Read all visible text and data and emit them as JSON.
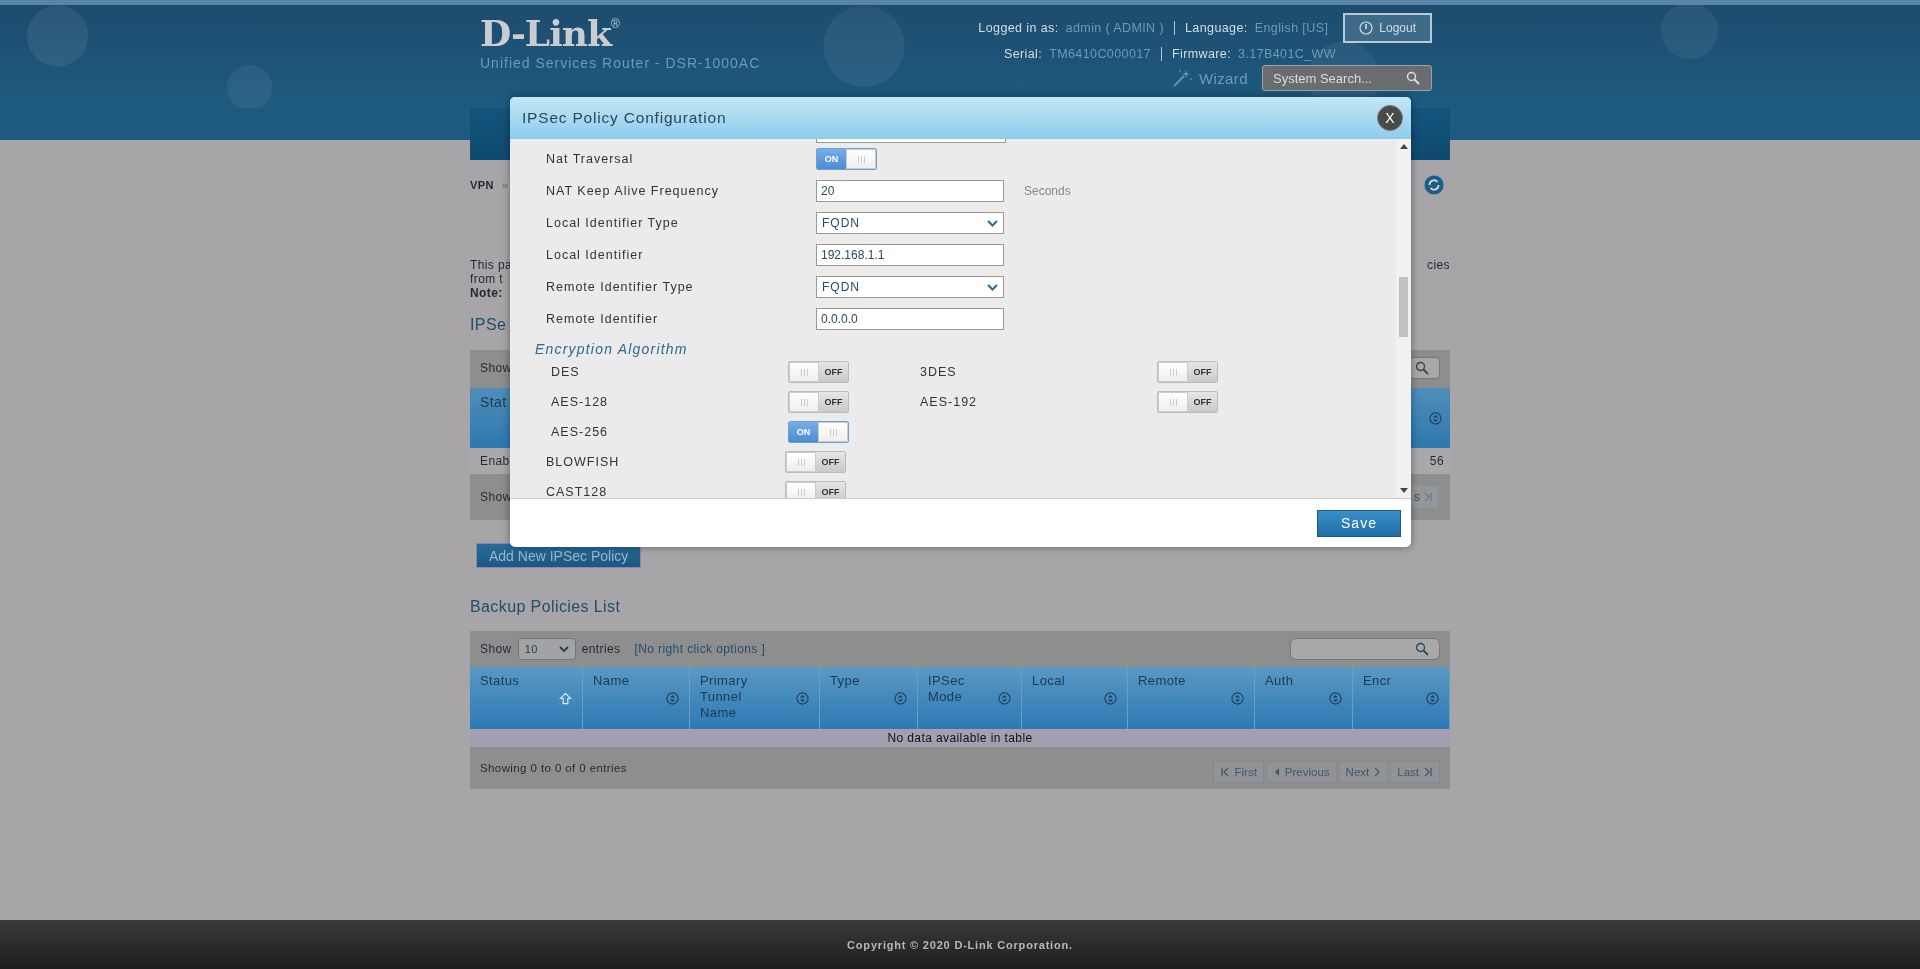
{
  "header": {
    "brand": "D-Link",
    "trademark": "®",
    "subtitle": "Unified Services Router - DSR-1000AC",
    "logged_in_label": "Logged in as:",
    "user": "admin ( ADMIN )",
    "language_label": "Language:",
    "language": "English [US]",
    "logout": "Logout",
    "serial_label": "Serial:",
    "serial": "TM6410C000017",
    "firmware_label": "Firmware:",
    "firmware": "3.17B401C_WW",
    "wizard": "Wizard",
    "search_placeholder": "System Search..."
  },
  "page": {
    "breadcrumb": "VPN",
    "breadcrumb_sep": "»",
    "intro_lines": [
      "This pa",
      "from t",
      "Note:"
    ],
    "intro_tail": "cies"
  },
  "policies": {
    "title": "IPSe",
    "show_label": "Show",
    "status_header": "Stat",
    "row_status": "Enab",
    "row_end": "56",
    "footer_text": "Show",
    "pager_fragment": "s"
  },
  "add_button": "Add New IPSec Policy",
  "backup": {
    "title": "Backup Policies List",
    "show_label": "Show",
    "page_size": "10",
    "entries_label": "entries",
    "hint": "[No right click options ]",
    "columns": [
      {
        "label": "Status",
        "sorted": true
      },
      {
        "label": "Name",
        "sorted": false
      },
      {
        "label": "Primary Tunnel Name",
        "sorted": false
      },
      {
        "label": "Type",
        "sorted": false
      },
      {
        "label": "IPSec Mode",
        "sorted": false
      },
      {
        "label": "Local",
        "sorted": false
      },
      {
        "label": "Remote",
        "sorted": false
      },
      {
        "label": "Auth",
        "sorted": false
      },
      {
        "label": "Encr",
        "sorted": false
      }
    ],
    "empty": "No data available in table",
    "info": "Showing 0 to 0 of 0 entries",
    "pager": [
      {
        "label": "First",
        "disabled": true
      },
      {
        "label": "Previous",
        "disabled": true
      },
      {
        "label": "Next",
        "disabled": true
      },
      {
        "label": "Last",
        "disabled": true
      }
    ]
  },
  "modal": {
    "title": "IPSec Policy Configuration",
    "close": "X",
    "fields": [
      {
        "kind": "toggle",
        "label": "Nat Traversal",
        "on": true,
        "text": "ON"
      },
      {
        "kind": "input",
        "label": "NAT Keep Alive Frequency",
        "value": "20",
        "unit": "Seconds"
      },
      {
        "kind": "select",
        "label": "Local Identifier Type",
        "value": "FQDN"
      },
      {
        "kind": "input",
        "label": "Local Identifier",
        "value": "192.168.1.1"
      },
      {
        "kind": "select",
        "label": "Remote Identifier Type",
        "value": "FQDN"
      },
      {
        "kind": "input",
        "label": "Remote Identifier",
        "value": "0.0.0.0"
      }
    ],
    "section": "Encryption Algorithm",
    "algorithm_rows": [
      [
        {
          "label": "DES",
          "on": false,
          "text": "OFF"
        },
        {
          "label": "3DES",
          "on": false,
          "text": "OFF"
        }
      ],
      [
        {
          "label": "AES-128",
          "on": false,
          "text": "OFF"
        },
        {
          "label": "AES-192",
          "on": false,
          "text": "OFF"
        }
      ],
      [
        {
          "label": "AES-256",
          "on": true,
          "text": "ON"
        }
      ],
      [
        {
          "label": "BLOWFISH",
          "on": false,
          "text": "OFF"
        }
      ],
      [
        {
          "label": "CAST128",
          "on": false,
          "text": "OFF"
        }
      ]
    ],
    "save": "Save"
  },
  "footer": {
    "copyright": "Copyright © 2020 D-Link Corporation."
  }
}
